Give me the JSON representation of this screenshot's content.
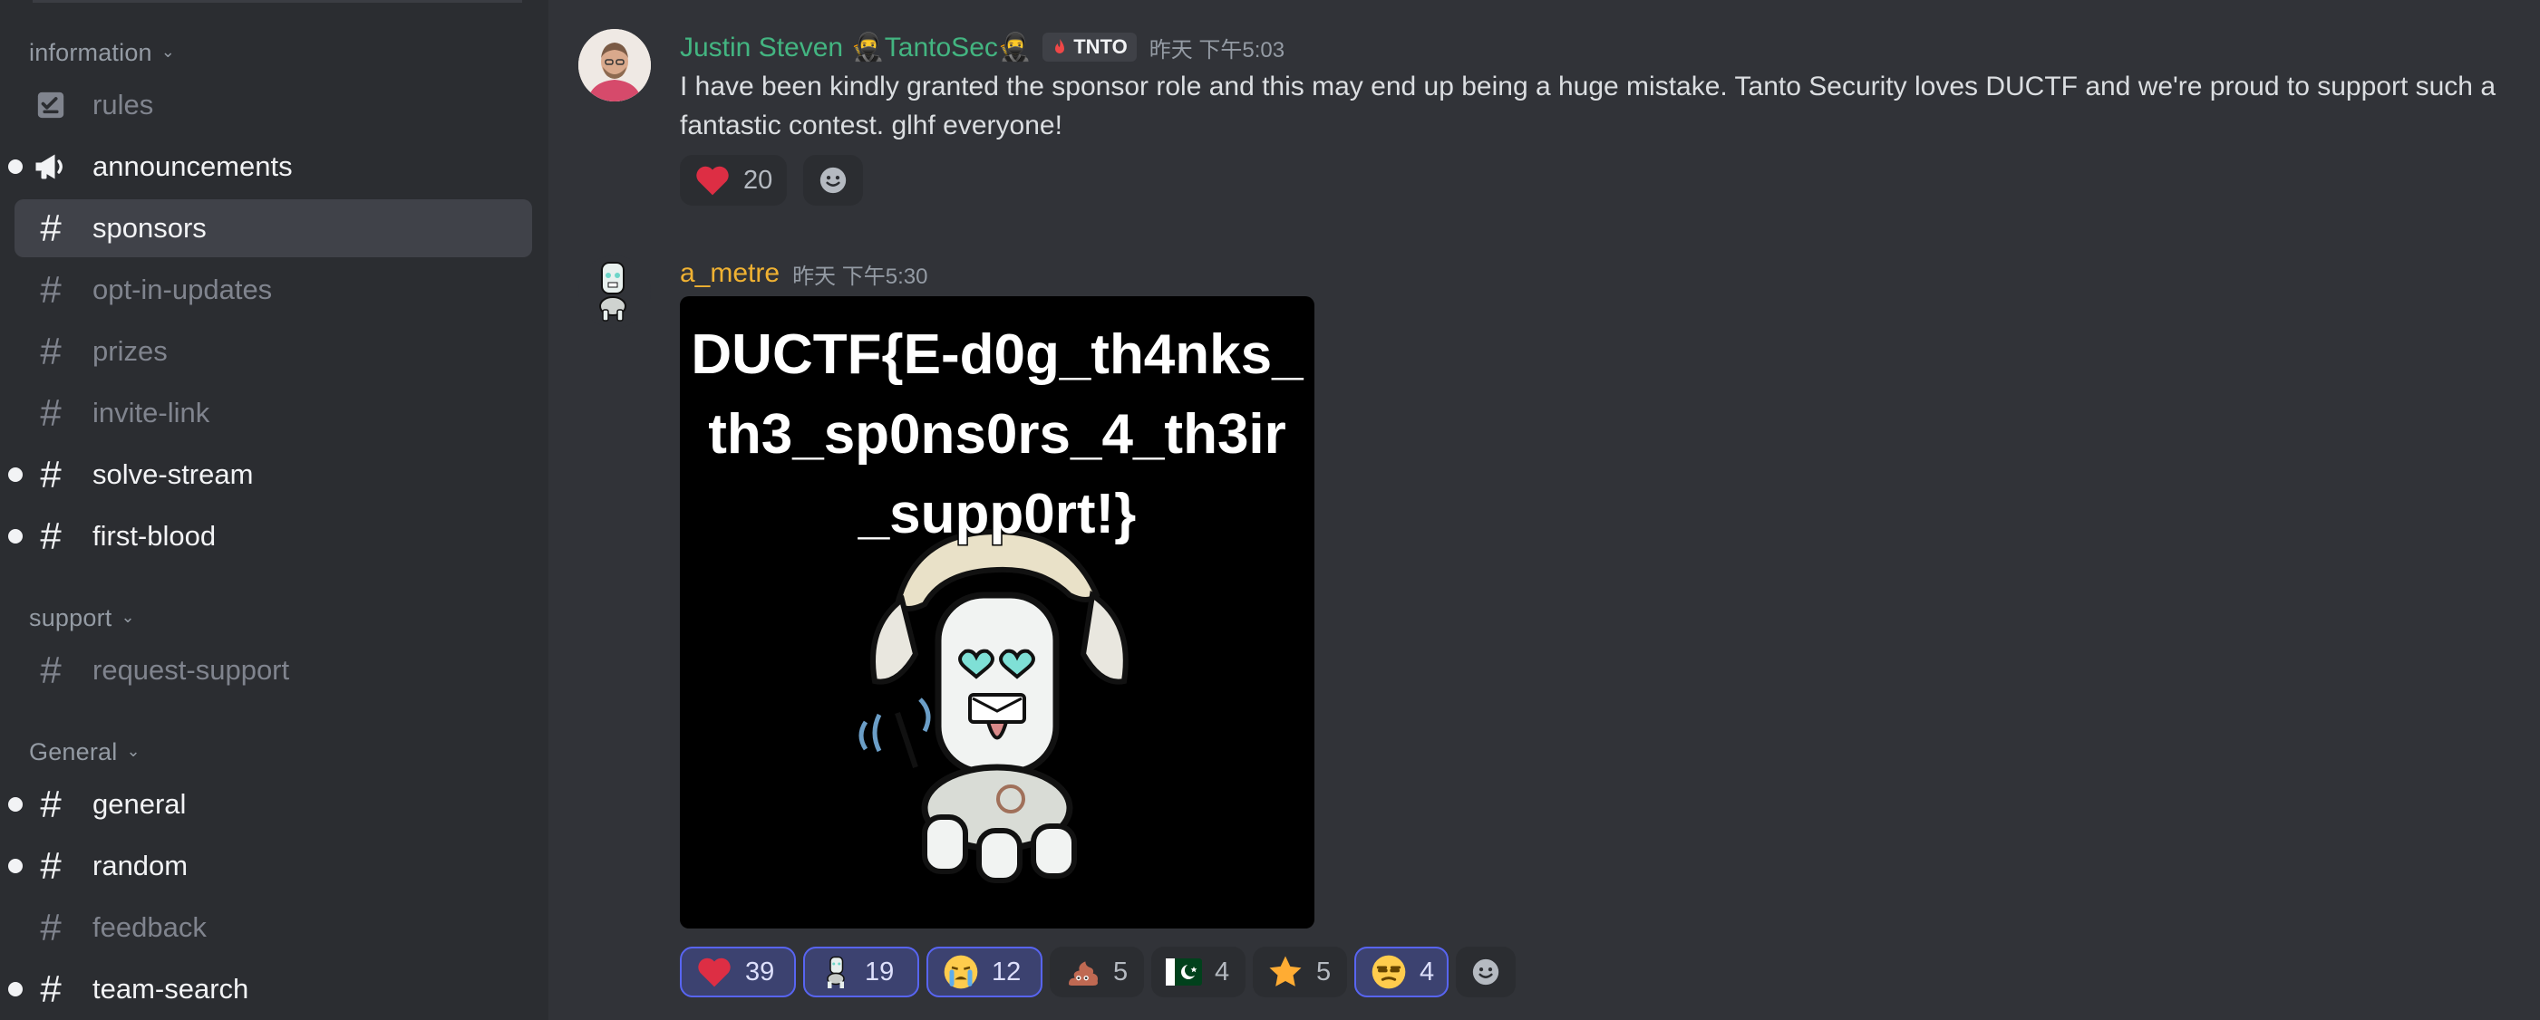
{
  "sidebar": {
    "categories": [
      {
        "label": "information"
      },
      {
        "label": "support"
      },
      {
        "label": "General"
      }
    ],
    "channels": [
      {
        "name": "rules",
        "icon": "rules-icon"
      },
      {
        "name": "announcements",
        "icon": "megaphone-icon"
      },
      {
        "name": "sponsors",
        "icon": "hash-icon"
      },
      {
        "name": "opt-in-updates",
        "icon": "hash-icon"
      },
      {
        "name": "prizes",
        "icon": "hash-icon"
      },
      {
        "name": "invite-link",
        "icon": "hash-icon"
      },
      {
        "name": "solve-stream",
        "icon": "hash-icon"
      },
      {
        "name": "first-blood",
        "icon": "hash-icon"
      },
      {
        "name": "request-support",
        "icon": "hash-icon"
      },
      {
        "name": "general",
        "icon": "hash-icon"
      },
      {
        "name": "random",
        "icon": "hash-icon"
      },
      {
        "name": "feedback",
        "icon": "hash-icon"
      },
      {
        "name": "team-search",
        "icon": "hash-icon"
      }
    ],
    "selected_channel": "sponsors"
  },
  "messages": [
    {
      "author": "Justin Steven 🥷TantoSec🥷",
      "tag": "TNTO",
      "timestamp": "昨天 下午5:03",
      "text": "I have been kindly granted the sponsor role and this may end up being a huge mistake. Tanto Security loves DUCTF and we're proud to support such a fantastic contest. glhf everyone!",
      "reactions": [
        {
          "emoji": "heart-icon",
          "count": "20"
        }
      ]
    },
    {
      "author": "a_metre",
      "timestamp": "昨天 下午5:30",
      "image_text": [
        "DUCTF{E-d0g_th4nks_",
        "th3_sp0ns0rs_4_th3ir",
        "_supp0rt!}"
      ],
      "reactions": [
        {
          "emoji": "heart-icon",
          "count": "39"
        },
        {
          "emoji": "robot-emoji-icon",
          "count": "19"
        },
        {
          "emoji": "crying-face-icon",
          "count": "12"
        },
        {
          "emoji": "poop-icon",
          "count": "5"
        },
        {
          "emoji": "pakistan-flag-icon",
          "count": "4"
        },
        {
          "emoji": "star-icon",
          "count": "5"
        },
        {
          "emoji": "unamused-face-icon",
          "count": "4"
        }
      ]
    }
  ],
  "colors": {
    "sidebar_bg": "#2b2d31",
    "chat_bg": "#313338",
    "selected_bg": "#404249",
    "author1": "#43b581",
    "author2": "#f0b232",
    "reaction_active_border": "#5865f2"
  }
}
